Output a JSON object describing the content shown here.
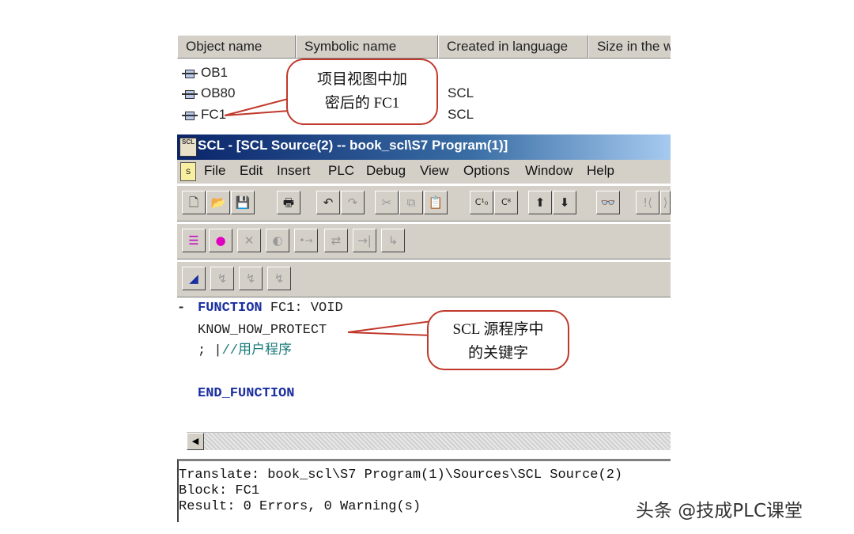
{
  "object_list": {
    "columns": [
      "Object name",
      "Symbolic name",
      "Created in language",
      "Size in the w"
    ],
    "rows": [
      {
        "name": "OB1",
        "language": ""
      },
      {
        "name": "OB80",
        "language": "SCL"
      },
      {
        "name": "FC1",
        "language": "SCL"
      }
    ]
  },
  "callouts": {
    "project_view": {
      "line1": "项目视图中加",
      "line2": "密后的 FC1"
    },
    "keyword": {
      "line1": "SCL 源程序中",
      "line2": "的关键字"
    }
  },
  "window": {
    "title": "SCL  - [SCL Source(2) -- book_scl\\S7 Program(1)]",
    "app_icon_text": "SCL"
  },
  "menu": [
    "File",
    "Edit",
    "Insert",
    "PLC",
    "Debug",
    "View",
    "Options",
    "Window",
    "Help"
  ],
  "toolbar1": {
    "icons": [
      "new-icon",
      "open-icon",
      "save-icon",
      "print-icon",
      "undo-icon",
      "redo-icon",
      "cut-icon",
      "copy-icon",
      "paste-icon",
      "compile-icon",
      "compile-all-icon",
      "download-icon",
      "upload-icon",
      "monitor-icon",
      "goto-start-icon",
      "goto-end-icon"
    ],
    "glyphs": [
      "🗋",
      "📂",
      "💾",
      "🖶",
      "↶",
      "↷",
      "✂",
      "⧉",
      "📋",
      "C¹₀",
      "C⁸",
      "⬆",
      "⬇",
      "👓",
      "!⟨",
      "⟩"
    ]
  },
  "toolbar2": {
    "icons": [
      "list-icon",
      "breakpoint-icon",
      "clear-breakpoint-icon",
      "breakpoint-active-icon",
      "next-statement-icon",
      "step-icon",
      "step-out-icon",
      "step-into-icon"
    ],
    "glyphs": [
      "☰",
      "●",
      "✕",
      "◐",
      "•→",
      "⇄",
      "→|",
      "↳"
    ]
  },
  "toolbar3": {
    "icons": [
      "bookmark-icon",
      "bookmark-next-icon",
      "bookmark-prev-icon",
      "bookmark-clear-icon"
    ],
    "glyphs": [
      "◢",
      "↯",
      "↯",
      "↯"
    ]
  },
  "editor": {
    "collapse_marker": "-",
    "lines": [
      {
        "kw": "FUNCTION",
        "rest": " FC1: VOID"
      },
      {
        "text": "KNOW_HOW_PROTECT"
      },
      {
        "text": ";",
        "cursor": "|",
        "comment": "//用户程序"
      },
      {
        "kw": "END_FUNCTION",
        "rest": ""
      }
    ]
  },
  "output": {
    "lines": [
      "Translate: book_scl\\S7 Program(1)\\Sources\\SCL Source(2)",
      "Block: FC1",
      "Result: 0 Errors, 0 Warning(s)"
    ]
  },
  "watermark": "头条 @技成PLC课堂",
  "colors": {
    "callout_border": "#c0392b",
    "keyword": "#1a2fa0",
    "comment": "#1a7a7a",
    "titlebar": "#0a246a"
  }
}
